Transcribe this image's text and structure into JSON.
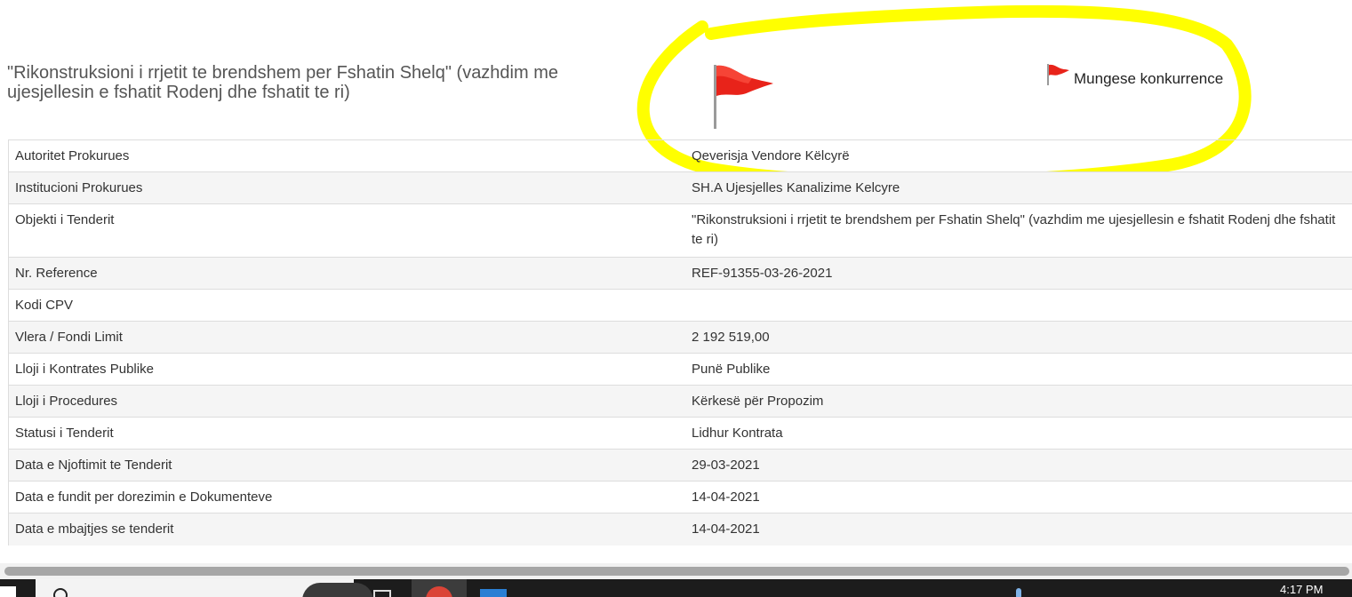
{
  "tender": {
    "title": "\"Rikonstruksioni i rrjetit te brendshem per Fshatin Shelq\" (vazhdim me ujesjellesin e fshatit Rodenj dhe fshatit te ri)",
    "flag_label": "Mungese konkurrence",
    "flag_color": "#e8231a",
    "highlight_color": "#ffff00"
  },
  "details": [
    {
      "label": "Autoritet Prokurues",
      "value": "Qeverisja Vendore Këlcyrë"
    },
    {
      "label": "Institucioni Prokurues",
      "value": "SH.A Ujesjelles Kanalizime Kelcyre"
    },
    {
      "label": "Objekti i Tenderit",
      "value": "\"Rikonstruksioni i rrjetit te brendshem per Fshatin Shelq\" (vazhdim me ujesjellesin e fshatit Rodenj dhe fshatit te ri)"
    },
    {
      "label": "Nr. Reference",
      "value": "REF-91355-03-26-2021"
    },
    {
      "label": "Kodi CPV",
      "value": ""
    },
    {
      "label": "Vlera / Fondi Limit",
      "value": "2 192 519,00"
    },
    {
      "label": "Lloji i Kontrates Publike",
      "value": "Punë Publike"
    },
    {
      "label": "Lloji i Procedures",
      "value": "Kërkesë për Propozim"
    },
    {
      "label": "Statusi i Tenderit",
      "value": "Lidhur Kontrata"
    },
    {
      "label": "Data e Njoftimit te Tenderit",
      "value": "29-03-2021"
    },
    {
      "label": "Data e fundit per dorezimin e Dokumenteve",
      "value": "14-04-2021"
    },
    {
      "label": "Data e mbajtjes se tenderit",
      "value": "14-04-2021"
    }
  ],
  "taskbar": {
    "time": "4:17 PM",
    "icons": [
      "windows-icon",
      "search-icon",
      "task-view-icon",
      "chrome-icon",
      "app-icon",
      "microphone-icon"
    ]
  }
}
